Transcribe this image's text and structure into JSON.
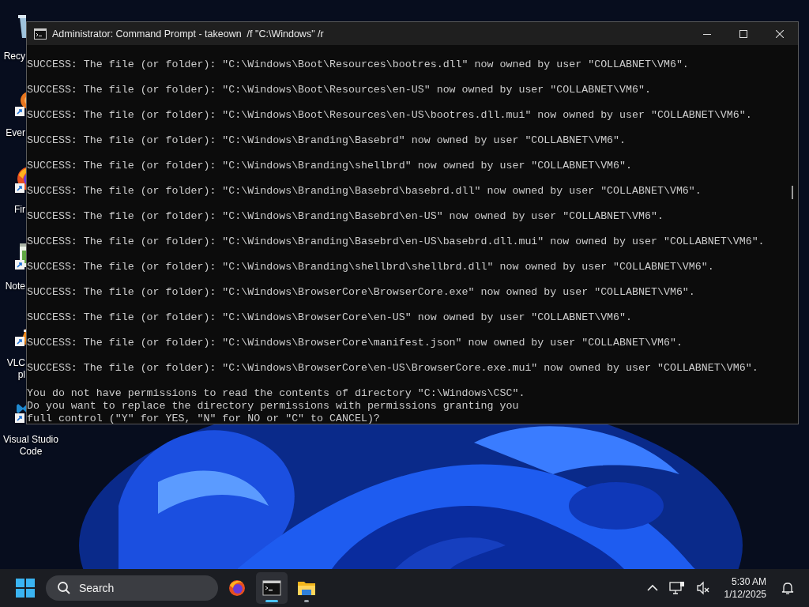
{
  "desktop_icons": [
    {
      "kind": "recycle",
      "lines": [
        "Recy"
      ]
    },
    {
      "kind": "everything",
      "lines": [
        "Ever"
      ]
    },
    {
      "kind": "firefox",
      "lines": [
        "Fir"
      ]
    },
    {
      "kind": "notepad",
      "lines": [
        "Note"
      ]
    },
    {
      "kind": "vlc",
      "lines": [
        "VLC",
        "pl"
      ]
    },
    {
      "kind": "vscode",
      "lines": [
        "Visual Studio",
        "Code"
      ]
    }
  ],
  "window": {
    "title": "Administrator: Command Prompt - takeown  /f \"C:\\Windows\" /r",
    "output": [
      "SUCCESS: The file (or folder): \"C:\\Windows\\Boot\\Resources\\bootres.dll\" now owned by user \"COLLABNET\\VM6\".",
      "SUCCESS: The file (or folder): \"C:\\Windows\\Boot\\Resources\\en-US\" now owned by user \"COLLABNET\\VM6\".",
      "SUCCESS: The file (or folder): \"C:\\Windows\\Boot\\Resources\\en-US\\bootres.dll.mui\" now owned by user \"COLLABNET\\VM6\".",
      "SUCCESS: The file (or folder): \"C:\\Windows\\Branding\\Basebrd\" now owned by user \"COLLABNET\\VM6\".",
      "SUCCESS: The file (or folder): \"C:\\Windows\\Branding\\shellbrd\" now owned by user \"COLLABNET\\VM6\".",
      "SUCCESS: The file (or folder): \"C:\\Windows\\Branding\\Basebrd\\basebrd.dll\" now owned by user \"COLLABNET\\VM6\".",
      "SUCCESS: The file (or folder): \"C:\\Windows\\Branding\\Basebrd\\en-US\" now owned by user \"COLLABNET\\VM6\".",
      "SUCCESS: The file (or folder): \"C:\\Windows\\Branding\\Basebrd\\en-US\\basebrd.dll.mui\" now owned by user \"COLLABNET\\VM6\".",
      "SUCCESS: The file (or folder): \"C:\\Windows\\Branding\\shellbrd\\shellbrd.dll\" now owned by user \"COLLABNET\\VM6\".",
      "SUCCESS: The file (or folder): \"C:\\Windows\\BrowserCore\\BrowserCore.exe\" now owned by user \"COLLABNET\\VM6\".",
      "SUCCESS: The file (or folder): \"C:\\Windows\\BrowserCore\\en-US\" now owned by user \"COLLABNET\\VM6\".",
      "SUCCESS: The file (or folder): \"C:\\Windows\\BrowserCore\\manifest.json\" now owned by user \"COLLABNET\\VM6\".",
      "SUCCESS: The file (or folder): \"C:\\Windows\\BrowserCore\\en-US\\BrowserCore.exe.mui\" now owned by user \"COLLABNET\\VM6\"."
    ],
    "prompt": [
      "You do not have permissions to read the contents of directory \"C:\\Windows\\CSC\".",
      "Do you want to replace the directory permissions with permissions granting you",
      "full control (\"Y\" for YES, \"N\" for NO or \"C\" to CANCEL)?"
    ]
  },
  "taskbar": {
    "search": {
      "label": "Search"
    },
    "apps": [
      {
        "kind": "firefox",
        "running": false,
        "selected": false
      },
      {
        "kind": "terminal",
        "running": true,
        "selected": true
      },
      {
        "kind": "folder",
        "running": true,
        "selected": false
      }
    ],
    "clock": {
      "time": "5:30 AM",
      "date": "1/12/2025"
    }
  }
}
